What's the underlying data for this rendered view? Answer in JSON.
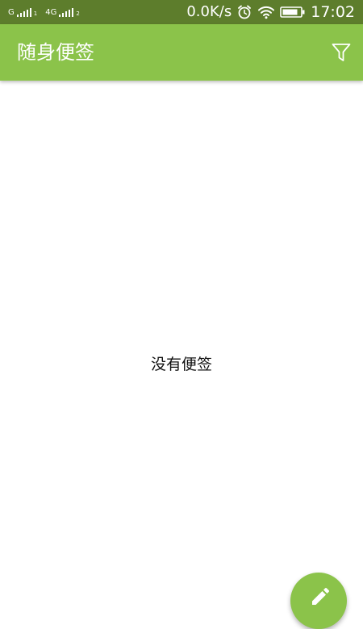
{
  "status_bar": {
    "sim1_label": "G",
    "sim1_sub": "1",
    "sim2_label": "4G",
    "sim2_sub": "2",
    "net_speed": "0.0K/s",
    "time": "17:02",
    "icons": [
      "signal-icon",
      "alarm-icon",
      "wifi-icon",
      "battery-icon"
    ]
  },
  "app_bar": {
    "title": "随身便签",
    "filter_icon": "filter-icon"
  },
  "main": {
    "empty_text": "没有便签"
  },
  "fab": {
    "icon": "pencil-icon"
  },
  "colors": {
    "status_bar": "#5d7d2c",
    "primary": "#8bc34a",
    "background": "#ffffff",
    "text": "#111111"
  }
}
